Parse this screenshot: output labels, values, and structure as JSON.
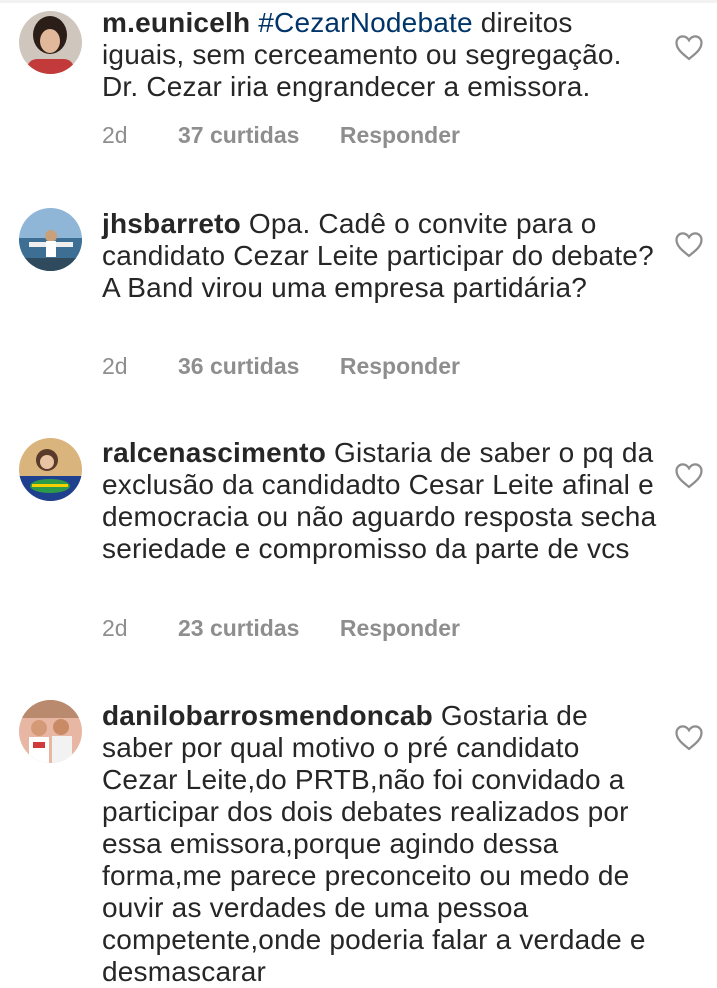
{
  "comments": [
    {
      "username": "m.eunicelh",
      "hashtag": "#CezarNodebate",
      "text": " direitos iguais, sem cerceamento ou segregação. Dr. Cezar iria engrandecer a emissora.",
      "time": "2d",
      "likes": "37 curtidas",
      "reply": "Responder",
      "icon": "heart-outline-icon"
    },
    {
      "username": "jhsbarreto",
      "text": " Opa. Cadê o convite para o candidato Cezar Leite participar do debate? A Band virou uma empresa partidária?",
      "time": "2d",
      "likes": "36 curtidas",
      "reply": "Responder",
      "icon": "heart-outline-icon"
    },
    {
      "username": "ralcenascimento",
      "text": " Gistaria de saber o pq da exclusão da candidadto Cesar Leite afinal e democracia ou não aguardo resposta secha seriedade e compromisso da parte de vcs",
      "time": "2d",
      "likes": "23 curtidas",
      "reply": "Responder",
      "icon": "heart-outline-icon"
    },
    {
      "username": "danilobarrosmendoncab",
      "text": " Gostaria de saber por qual motivo o pré candidato Cezar Leite,do PRTB,não foi convidado a participar dos dois debates realizados por essa emissora,porque agindo dessa forma,me parece preconceito ou medo de ouvir as verdades de uma pessoa competente,onde poderia falar a verdade e desmascarar",
      "icon": "heart-outline-icon"
    }
  ],
  "colors": {
    "text": "#262626",
    "meta": "#8e8e8e",
    "hashtag": "#003569",
    "icon": "#8e8e8e"
  }
}
